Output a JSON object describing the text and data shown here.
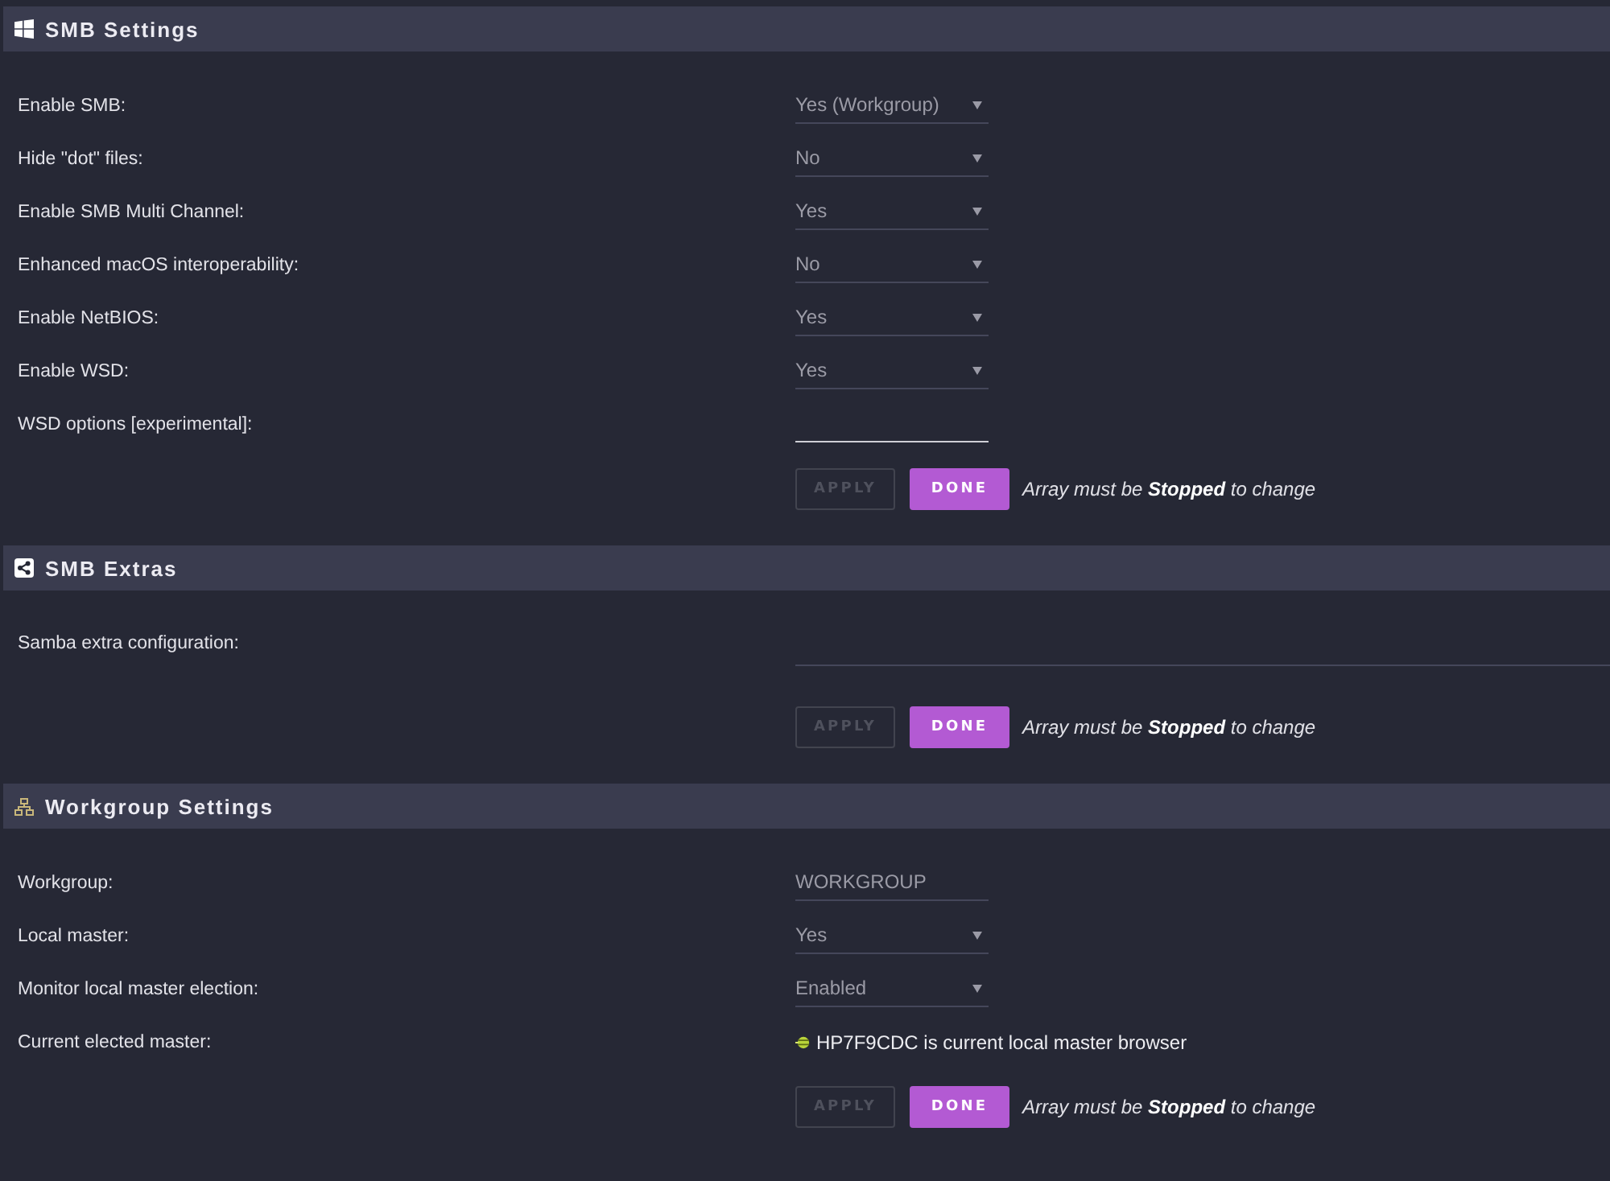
{
  "sections": [
    {
      "title": "SMB Settings",
      "rows": [
        {
          "label": "Enable SMB:",
          "kind": "select",
          "value": "Yes (Workgroup)"
        },
        {
          "label": "Hide \"dot\" files:",
          "kind": "select",
          "value": "No"
        },
        {
          "label": "Enable SMB Multi Channel:",
          "kind": "select",
          "value": "Yes"
        },
        {
          "label": "Enhanced macOS interoperability:",
          "kind": "select",
          "value": "No"
        },
        {
          "label": "Enable NetBIOS:",
          "kind": "select",
          "value": "Yes"
        },
        {
          "label": "Enable WSD:",
          "kind": "select",
          "value": "Yes"
        },
        {
          "label": "WSD options [experimental]:",
          "kind": "text",
          "focused": true
        }
      ],
      "buttons": [
        {
          "label": "APPLY",
          "kind": "apply",
          "disabled": true
        },
        {
          "label": "DONE",
          "kind": "done",
          "disabled": false
        }
      ],
      "note": "Array must be **Stopped** to change"
    },
    {
      "title": "SMB Extras",
      "rows": [
        {
          "label": "Samba extra configuration:",
          "kind": "textarea"
        }
      ],
      "buttons": [
        {
          "label": "APPLY",
          "kind": "apply",
          "disabled": true
        },
        {
          "label": "DONE",
          "kind": "done",
          "disabled": false
        }
      ],
      "note": "Array must be **Stopped** to change"
    },
    {
      "title": "Workgroup Settings",
      "rows": [
        {
          "label": "Workgroup:",
          "kind": "text",
          "value": "WORKGROUP",
          "focused": false
        },
        {
          "label": "Local master:",
          "kind": "select",
          "value": "Yes"
        },
        {
          "label": "Monitor local master election:",
          "kind": "select",
          "value": "Enabled"
        },
        {
          "label": "Current elected master:",
          "kind": "status",
          "value": "HP7F9CDC is current local master browser"
        }
      ],
      "buttons": [
        {
          "label": "APPLY",
          "kind": "apply",
          "disabled": true
        },
        {
          "label": "DONE",
          "kind": "done",
          "disabled": false
        }
      ],
      "note": "Array must be **Stopped** to change"
    }
  ]
}
